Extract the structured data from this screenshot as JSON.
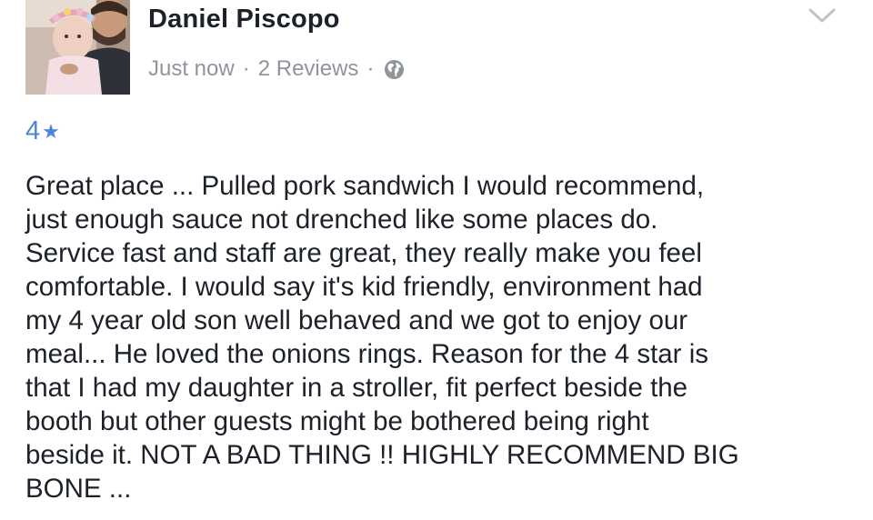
{
  "post": {
    "author_name": "Daniel Piscopo",
    "timestamp": "Just now",
    "separator": "·",
    "reviews_count": "2 Reviews",
    "privacy_icon": "globe-icon",
    "options_icon": "chevron-down-icon"
  },
  "review": {
    "rating": "4",
    "star": "★",
    "lines": [
      "Great place ... Pulled pork sandwich I would recommend,",
      "just enough sauce not drenched like some places do.",
      "Service fast and staff are great, they really make you feel",
      "comfortable. I would say it's kid  friendly, environment had",
      "my 4 year old son well behaved and we got to enjoy our",
      "meal... He loved the onions rings. Reason for the 4 star is",
      "that I had my daughter in a stroller, fit perfect beside the",
      "booth but other guests might be bothered being right",
      "beside it. NOT A BAD THING !! HIGHLY RECOMMEND BIG",
      "BONE ..."
    ]
  },
  "colors": {
    "text": "#1d2129",
    "meta": "#90949c",
    "rating": "#4b86d6",
    "chevron": "#bec2c9"
  }
}
